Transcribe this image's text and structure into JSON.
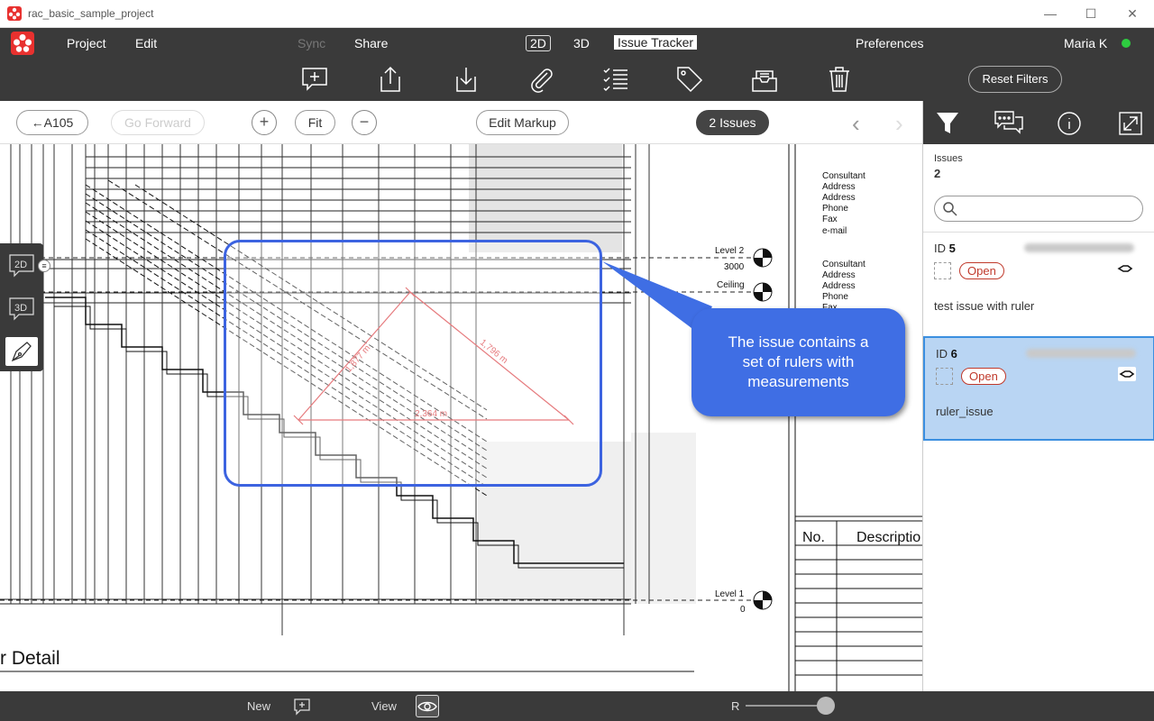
{
  "window": {
    "title": "rac_basic_sample_project",
    "minimize": "—",
    "maximize": "☐",
    "close": "✕"
  },
  "menu": {
    "project": "Project",
    "edit": "Edit",
    "sync": "Sync",
    "share": "Share",
    "view2d": "2D",
    "view3d": "3D",
    "issue_tracker": "Issue Tracker",
    "preferences": "Preferences",
    "user": "Maria K",
    "status_color": "#2ecc40"
  },
  "toolbar": {
    "tools": [
      "add-comment-icon",
      "upload-icon",
      "download-icon",
      "attachment-icon",
      "checklist-icon",
      "tag-icon",
      "inbox-icon",
      "trash-icon"
    ],
    "reset_filters": "Reset Filters"
  },
  "nav": {
    "back": "←A105",
    "forward": "Go Forward",
    "zoom_in": "+",
    "fit": "Fit",
    "zoom_out": "−",
    "edit_markup": "Edit Markup",
    "issues_count": "2 Issues",
    "prev": "‹",
    "next": "›"
  },
  "panel": {
    "issues_label": "Issues",
    "issues_count": "2",
    "search_placeholder": "",
    "issues": [
      {
        "id_prefix": "ID",
        "id": "5",
        "status": "Open",
        "description": "test issue with ruler"
      },
      {
        "id_prefix": "ID",
        "id": "6",
        "status": "Open",
        "description": "ruler_issue"
      }
    ]
  },
  "side": {
    "view2d": "2D",
    "view3d": "3D"
  },
  "drawing": {
    "levels": [
      {
        "name": "Level 2",
        "value": "3000"
      },
      {
        "name": "Ceiling",
        "value": ""
      },
      {
        "name": "Level 1",
        "value": "0"
      }
    ],
    "consultant_block": [
      "Consultant",
      "Address",
      "Address",
      "Phone",
      "Fax",
      "e-mail"
    ],
    "consultant_block2": [
      "Consultant",
      "Address",
      "Address",
      "Phone",
      "Fax"
    ],
    "table_headers": [
      "No.",
      "Descriptio"
    ],
    "detail_title": "r Detail",
    "measurements": [
      "1,877 m",
      "1,796 m",
      "2,364 m"
    ],
    "ruler_color": "#d9353a"
  },
  "callout": {
    "text_line1": "The issue contains a",
    "text_line2": "set of rulers with",
    "text_line3": "measurements"
  },
  "bottom": {
    "new_label": "New",
    "view_label": "View",
    "r_label": "R"
  }
}
